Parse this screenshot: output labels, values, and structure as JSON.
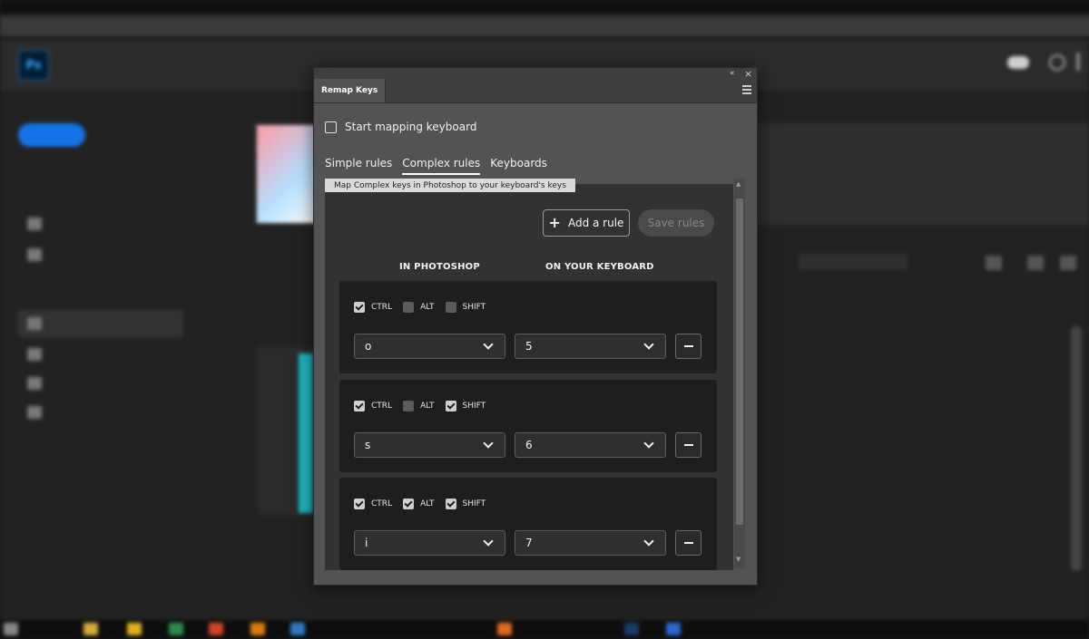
{
  "panel": {
    "tab_label": "Remap Keys",
    "start_mapping_label": "Start mapping keyboard",
    "tabs": [
      {
        "label": "Simple rules",
        "active": false
      },
      {
        "label": "Complex rules",
        "active": true
      },
      {
        "label": "Keyboards",
        "active": false
      }
    ],
    "tooltip": "Map Complex keys in Photoshop to your keyboard's keys",
    "add_rule_label": "Add a rule",
    "save_rules_label": "Save rules",
    "col_photoshop": "IN PHOTOSHOP",
    "col_keyboard": "ON YOUR KEYBOARD",
    "modifier_labels": {
      "ctrl": "CTRL",
      "alt": "ALT",
      "shift": "SHIFT"
    },
    "rules": [
      {
        "ctrl": true,
        "alt": false,
        "shift": false,
        "photoshop_key": "o",
        "keyboard_key": "5"
      },
      {
        "ctrl": true,
        "alt": false,
        "shift": true,
        "photoshop_key": "s",
        "keyboard_key": "6"
      },
      {
        "ctrl": true,
        "alt": true,
        "shift": true,
        "photoshop_key": "i",
        "keyboard_key": "7"
      }
    ]
  },
  "background": {
    "app_logo": "Ps",
    "icons": [
      "cloud-icon",
      "search-icon"
    ]
  },
  "colors": {
    "panel_bg": "#535353",
    "rule_bg": "#1e1e1e",
    "checkbox_checked": "#cfcfcf",
    "accent_blue": "#1473e6"
  }
}
